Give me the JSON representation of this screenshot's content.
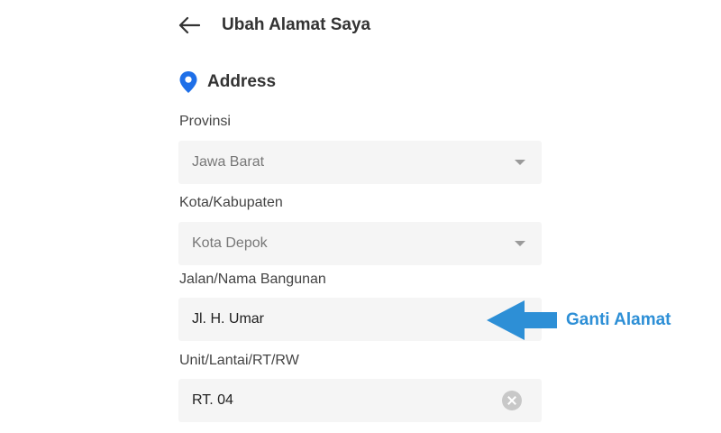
{
  "header": {
    "back_icon": "arrow-left-icon",
    "title": "Ubah Alamat Saya"
  },
  "section": {
    "icon": "location-pin-icon",
    "title": "Address",
    "accent_color": "#1e6fe8"
  },
  "form": {
    "province": {
      "label": "Provinsi",
      "value": "Jawa Barat"
    },
    "city": {
      "label": "Kota/Kabupaten",
      "value": "Kota Depok"
    },
    "street": {
      "label": "Jalan/Nama Bangunan",
      "value": "Jl. H. Umar"
    },
    "unit": {
      "label": "Unit/Lantai/RT/RW",
      "value": "RT. 04",
      "clear_icon": "clear-icon"
    }
  },
  "annotation": {
    "text": "Ganti Alamat",
    "color": "#2d8fd6",
    "icon": "arrow-left-annotation"
  }
}
